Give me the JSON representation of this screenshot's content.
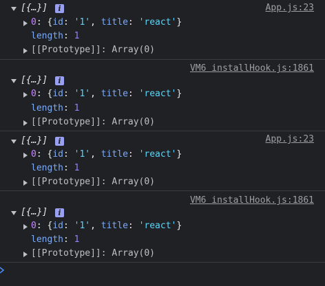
{
  "entries": [
    {
      "summary": "[{…}]",
      "source": "App.js:23",
      "item": {
        "index": "0",
        "id_key": "id",
        "id_val": "'1'",
        "title_key": "title",
        "title_val": "'react'"
      },
      "length_key": "length",
      "length_val": "1",
      "proto": "[[Prototype]]: Array(0)"
    },
    {
      "summary": "[{…}]",
      "source": "VM6 installHook.js:1861",
      "item": {
        "index": "0",
        "id_key": "id",
        "id_val": "'1'",
        "title_key": "title",
        "title_val": "'react'"
      },
      "length_key": "length",
      "length_val": "1",
      "proto": "[[Prototype]]: Array(0)"
    },
    {
      "summary": "[{…}]",
      "source": "App.js:23",
      "item": {
        "index": "0",
        "id_key": "id",
        "id_val": "'1'",
        "title_key": "title",
        "title_val": "'react'"
      },
      "length_key": "length",
      "length_val": "1",
      "proto": "[[Prototype]]: Array(0)"
    },
    {
      "summary": "[{…}]",
      "source": "VM6 installHook.js:1861",
      "item": {
        "index": "0",
        "id_key": "id",
        "id_val": "'1'",
        "title_key": "title",
        "title_val": "'react'"
      },
      "length_key": "length",
      "length_val": "1",
      "proto": "[[Prototype]]: Array(0)"
    }
  ],
  "info_badge": "i",
  "icons": {
    "expanded": "triangle-down-icon",
    "collapsed": "triangle-right-icon",
    "prompt": "chevron-right-icon"
  },
  "colors": {
    "background": "#202124",
    "key": "#7cacf8",
    "string": "#5cd5fb",
    "number": "#9980ff",
    "link": "#9aa0a6",
    "badge": "#9aa0f0",
    "prompt": "#4a8af4"
  }
}
